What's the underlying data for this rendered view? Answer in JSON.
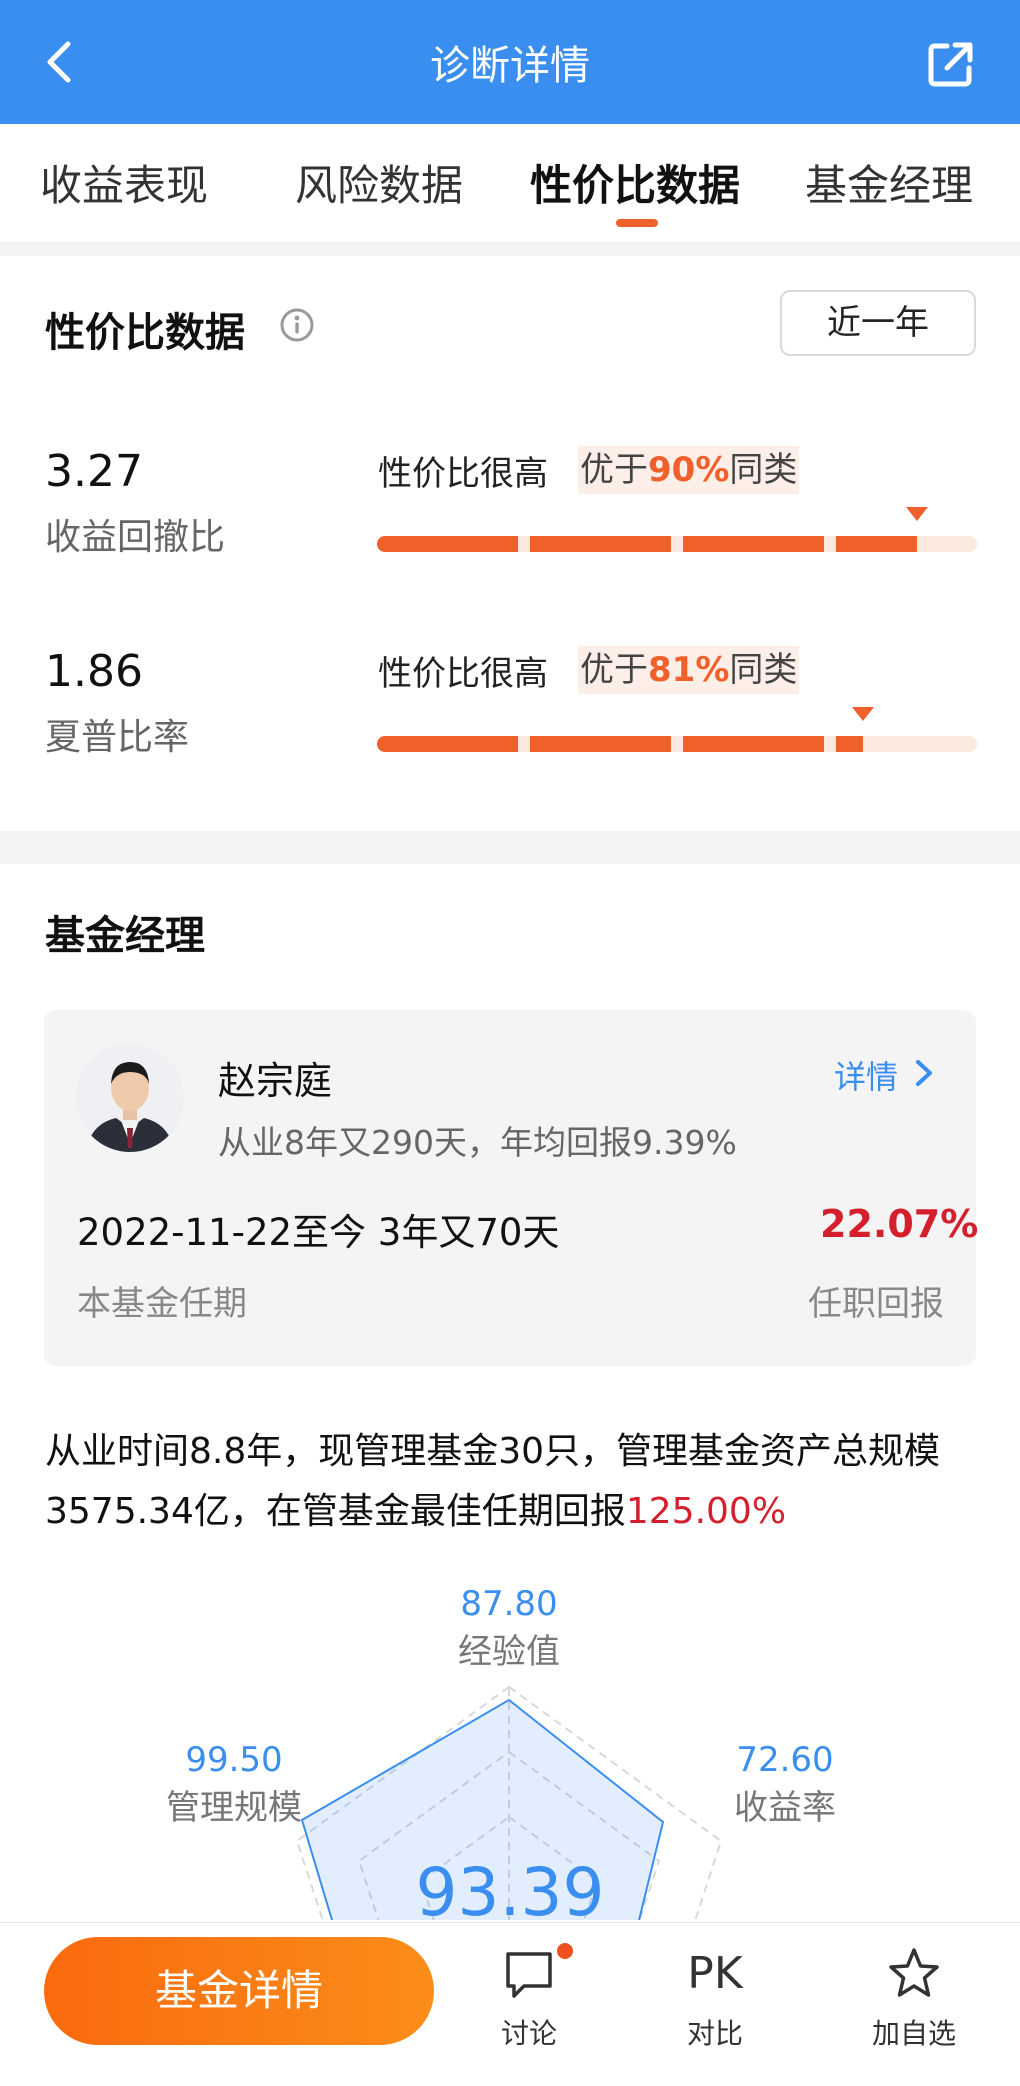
{
  "header": {
    "title": "诊断详情",
    "back_icon": "chevron-left-icon",
    "share_icon": "share-icon"
  },
  "tabs": [
    {
      "label": "收益表现",
      "active": false
    },
    {
      "label": "风险数据",
      "active": false
    },
    {
      "label": "性价比数据",
      "active": true
    },
    {
      "label": "基金经理",
      "active": false
    }
  ],
  "value_section": {
    "title": "性价比数据",
    "info_icon": "info-icon",
    "period": "近一年",
    "metrics": [
      {
        "value": "3.27",
        "label": "收益回撤比",
        "rating": "性价比很高",
        "compare_prefix": "优于",
        "percent": "90%",
        "compare_suffix": "同类",
        "level": 0.9
      },
      {
        "value": "1.86",
        "label": "夏普比率",
        "rating": "性价比很高",
        "compare_prefix": "优于",
        "percent": "81%",
        "compare_suffix": "同类",
        "level": 0.81
      }
    ]
  },
  "manager_section": {
    "title": "基金经理",
    "manager": {
      "name": "赵宗庭",
      "subtitle": "从业8年又290天，年均回报9.39%",
      "detail_link": "详情",
      "tenure": "2022-11-22至今 3年又70天",
      "tenure_label": "本基金任期",
      "tenure_return": "22.07%",
      "tenure_return_label": "任职回报"
    },
    "summary_text": "从业时间8.8年，现管理基金30只，管理基金资产总规模3575.34亿，在管基金最佳任期回报",
    "summary_highlight": "125.00%",
    "radar": {
      "score": "93.39",
      "axes": [
        {
          "label": "经验值",
          "value": "87.80"
        },
        {
          "label": "收益率",
          "value": "72.60"
        },
        {
          "label": "管理规模",
          "value": "99.50"
        }
      ]
    }
  },
  "bottom_bar": {
    "primary_button": "基金详情",
    "items": [
      {
        "label": "讨论",
        "icon": "comment-icon"
      },
      {
        "label": "对比",
        "icon": "PK"
      },
      {
        "label": "加自选",
        "icon": "star-icon"
      }
    ],
    "colors": {
      "accent": "#f0602b",
      "brand": "#3a8ef0",
      "positive": "#d4202c"
    }
  }
}
